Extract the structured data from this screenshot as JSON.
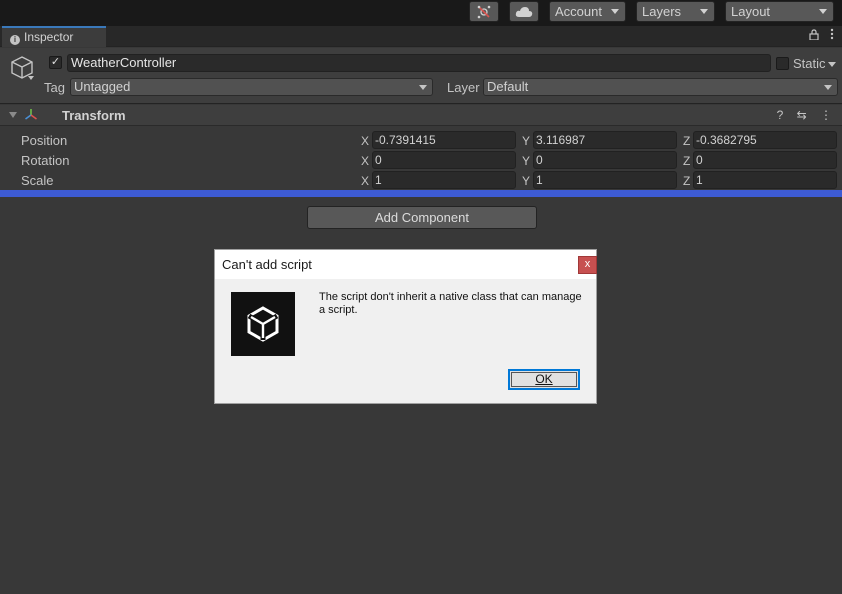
{
  "toolbar": {
    "collab_icon": "collab-icon",
    "cloud_icon": "cloud-icon",
    "account_label": "Account",
    "layers_label": "Layers",
    "layout_label": "Layout"
  },
  "tab": {
    "label": "Inspector",
    "lock_icon": "lock-icon",
    "menu_icon": "kebab-menu-icon"
  },
  "gameobject": {
    "active_checked": true,
    "name": "WeatherController",
    "static_label": "Static",
    "tag_label": "Tag",
    "tag_value": "Untagged",
    "layer_label": "Layer",
    "layer_value": "Default"
  },
  "transform": {
    "title": "Transform",
    "rows": [
      {
        "label": "Position",
        "x": "-0.7391415",
        "y": "3.116987",
        "z": "-0.3682795"
      },
      {
        "label": "Rotation",
        "x": "0",
        "y": "0",
        "z": "0"
      },
      {
        "label": "Scale",
        "x": "1",
        "y": "1",
        "z": "1"
      }
    ],
    "axis_x": "X",
    "axis_y": "Y",
    "axis_z": "Z"
  },
  "add_component_label": "Add Component",
  "dialog": {
    "title": "Can't add script",
    "close_glyph": "x",
    "message": "The script don't inherit a native class that can manage a script.",
    "ok_label": "OK"
  },
  "colors": {
    "accent_blue": "#3d5bd4",
    "panel": "#383838",
    "dialog_close": "#c75050"
  }
}
